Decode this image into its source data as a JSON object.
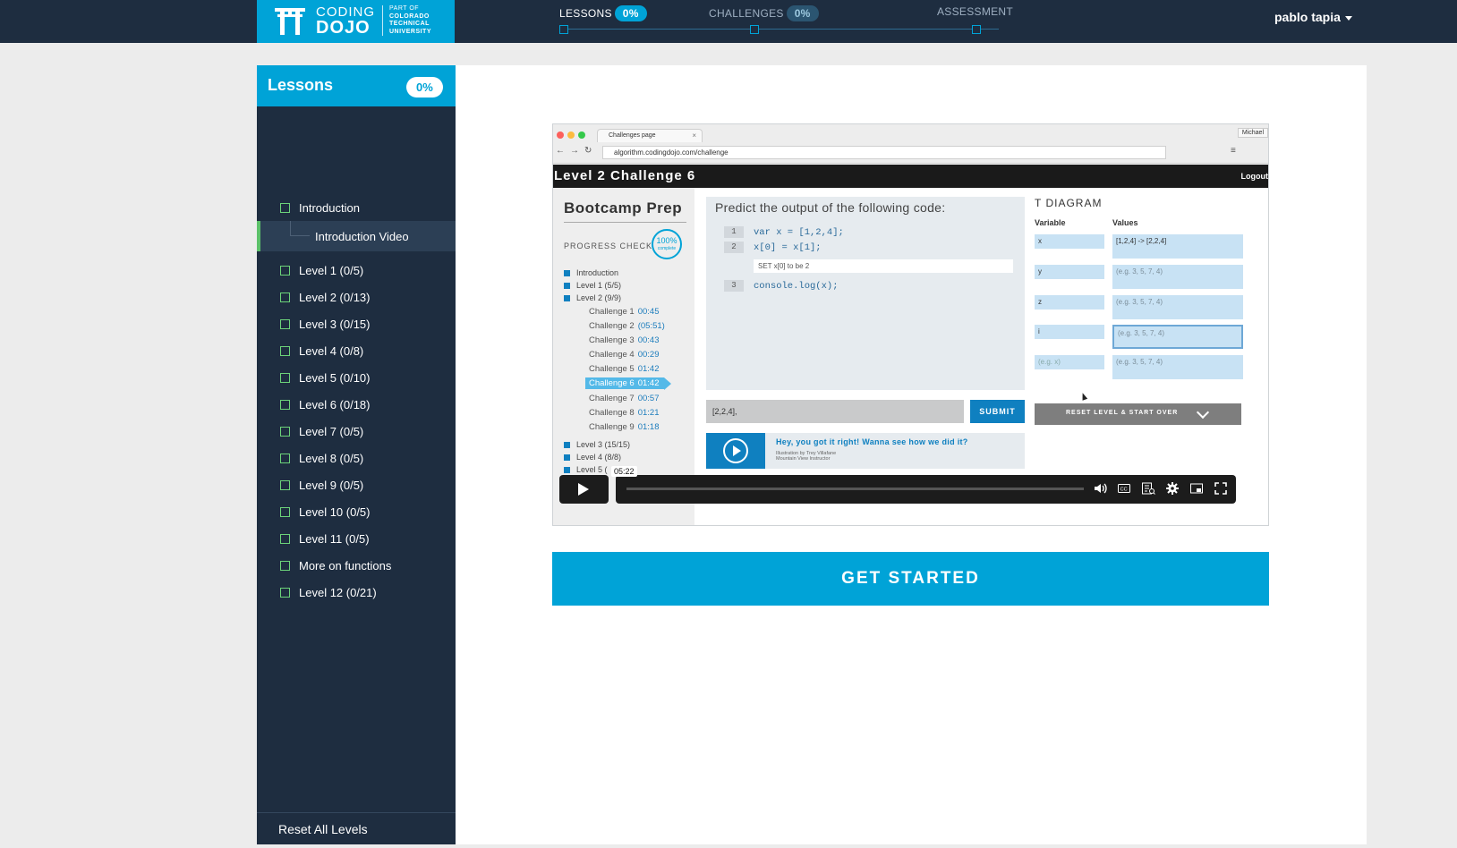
{
  "header": {
    "logo": {
      "line1": "CODING",
      "line2": "DOJO",
      "part_of": [
        "PART OF",
        "COLORADO",
        "TECHNICAL",
        "UNIVERSITY"
      ]
    },
    "steps": [
      {
        "label": "LESSONS",
        "percent": "0%"
      },
      {
        "label": "CHALLENGES",
        "percent": "0%"
      },
      {
        "label": "ASSESSMENT"
      }
    ],
    "user": "pablo tapia"
  },
  "sidebar": {
    "title": "Lessons",
    "percent": "0%",
    "items": [
      "Introduction",
      "Introduction Video",
      "Level 1 (0/5)",
      "Level 2 (0/13)",
      "Level 3 (0/15)",
      "Level 4 (0/8)",
      "Level 5 (0/10)",
      "Level 6 (0/18)",
      "Level 7 (0/5)",
      "Level 8 (0/5)",
      "Level 9 (0/5)",
      "Level 10 (0/5)",
      "Level 11 (0/5)",
      "More on functions",
      "Level 12 (0/21)"
    ],
    "reset_label": "Reset All Levels"
  },
  "video": {
    "browser": {
      "tab": "Challenges page",
      "url": "algorithm.codingdojo.com/challenge",
      "profile": "Michael"
    },
    "level_title": "Level 2 Challenge 6",
    "logout": "Logout",
    "prep": {
      "title": "Bootcamp Prep",
      "progress_label": "PROGRESS CHECK",
      "ring_value": "100%",
      "ring_sub": "complete",
      "items": [
        "Introduction",
        "Level 1 (5/5)",
        "Level 2 (9/9)"
      ],
      "challenges": [
        {
          "name": "Challenge 1",
          "time": "00:45"
        },
        {
          "name": "Challenge 2",
          "time": "(05:51)"
        },
        {
          "name": "Challenge 3",
          "time": "00:43"
        },
        {
          "name": "Challenge 4",
          "time": "00:29"
        },
        {
          "name": "Challenge 5",
          "time": "01:42"
        },
        {
          "name": "Challenge 6",
          "time": "01:42"
        },
        {
          "name": "Challenge 7",
          "time": "00:57"
        },
        {
          "name": "Challenge 8",
          "time": "01:21"
        },
        {
          "name": "Challenge 9",
          "time": "01:18"
        }
      ],
      "more": [
        "Level 3 (15/15)",
        "Level 4 (8/8)",
        "Level 5 ("
      ]
    },
    "code": {
      "question": "Predict the output of the following code:",
      "lines": [
        {
          "n": "1",
          "code": "var x = [1,2,4];"
        },
        {
          "n": "2",
          "code": "x[0] = x[1];"
        },
        {
          "n": "3",
          "code": "console.log(x);"
        }
      ],
      "hint": "SET x[0] to be 2",
      "answer": "[2,2,4],",
      "submit": "SUBMIT",
      "msg_title": "Hey, you got it right! Wanna see how we did it?",
      "msg_sub1": "Illustration by Trey Villafane",
      "msg_sub2": "Mountain View Instructor"
    },
    "tdiagram": {
      "title": "T DIAGRAM",
      "col_variable": "Variable",
      "col_values": "Values",
      "rows": [
        {
          "var": "x",
          "val": "[1,2,4] -> [2,2,4]"
        },
        {
          "var": "y",
          "val": "(e.g. 3, 5, 7, 4)"
        },
        {
          "var": "z",
          "val": "(e.g. 3, 5, 7, 4)"
        },
        {
          "var": "i",
          "val": "(e.g. 3, 5, 7, 4)"
        },
        {
          "var": "(e.g. x)",
          "val": "(e.g. 3, 5, 7, 4)"
        }
      ],
      "reset": "RESET LEVEL & START OVER"
    },
    "player": {
      "tooltip_time": "05:22",
      "played_fraction": 0.0
    }
  },
  "cta": "GET STARTED",
  "colors": {
    "brand": "#00a3d7",
    "nav_bg": "#1e2d40",
    "check_green": "#6cd37a"
  }
}
